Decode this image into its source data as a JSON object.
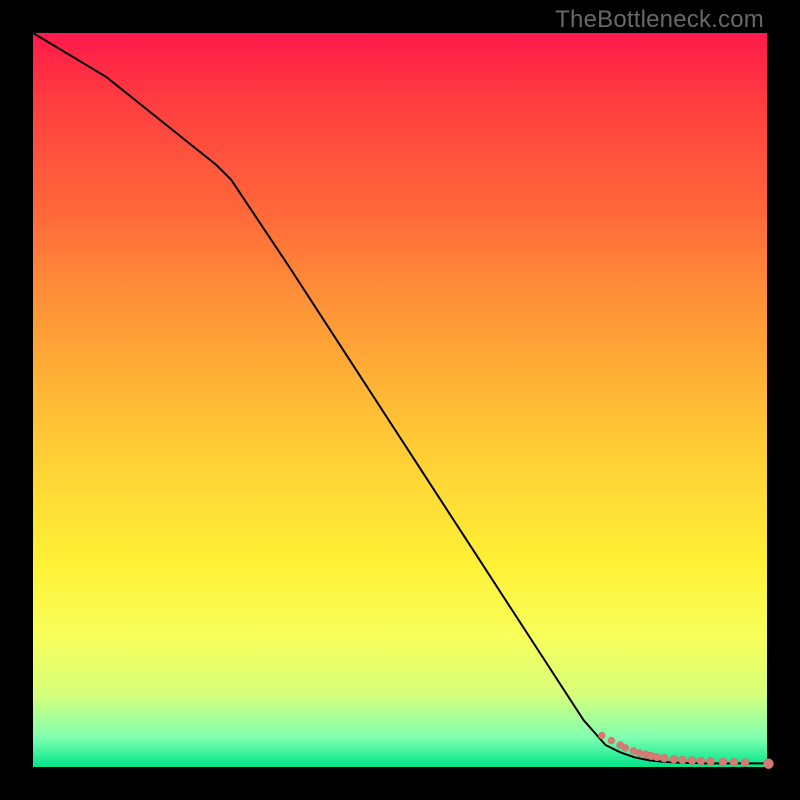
{
  "watermark": "TheBottleneck.com",
  "colors": {
    "frame": "#000000",
    "watermark_text": "#686868",
    "curve": "#000000",
    "dot_fill": "#d87a74",
    "gradient_top": "#ff1a4a",
    "gradient_bottom": "#00e58a"
  },
  "chart_data": {
    "type": "line",
    "title": "",
    "xlabel": "",
    "ylabel": "",
    "xlim": [
      0,
      100
    ],
    "ylim": [
      0,
      100
    ],
    "grid": false,
    "legend": false,
    "series": [
      {
        "name": "bottleneck-curve",
        "x": [
          0,
          5,
          10,
          15,
          20,
          25,
          27,
          30,
          35,
          40,
          45,
          50,
          55,
          60,
          65,
          70,
          75,
          78,
          80,
          82,
          84,
          86,
          88,
          90,
          92,
          94,
          96,
          98,
          100
        ],
        "y": [
          100,
          97,
          94,
          90,
          86,
          82,
          80,
          75.5,
          68,
          60.3,
          52.6,
          44.9,
          37.2,
          29.5,
          21.8,
          14.1,
          6.4,
          3.0,
          2.0,
          1.3,
          0.9,
          0.7,
          0.6,
          0.55,
          0.5,
          0.5,
          0.5,
          0.5,
          0.5
        ]
      }
    ],
    "scatter": [
      {
        "name": "data-points",
        "x": [
          77.5,
          78.8,
          80.0,
          80.7,
          81.8,
          82.6,
          83.5,
          84.2,
          85.0,
          86.0,
          87.3,
          88.5,
          89.8,
          91.0,
          92.3,
          94.0,
          95.5,
          97.0,
          100.2
        ],
        "y": [
          4.3,
          3.6,
          3.0,
          2.6,
          2.2,
          1.9,
          1.7,
          1.5,
          1.35,
          1.2,
          1.05,
          0.95,
          0.88,
          0.82,
          0.78,
          0.7,
          0.65,
          0.6,
          0.45
        ],
        "r": [
          3.5,
          3.5,
          3.5,
          3.5,
          3.5,
          3.5,
          3.8,
          3.8,
          3.8,
          4.0,
          4.0,
          4.0,
          4.0,
          4.0,
          4.0,
          4.0,
          4.0,
          4.0,
          5.0
        ]
      }
    ]
  }
}
